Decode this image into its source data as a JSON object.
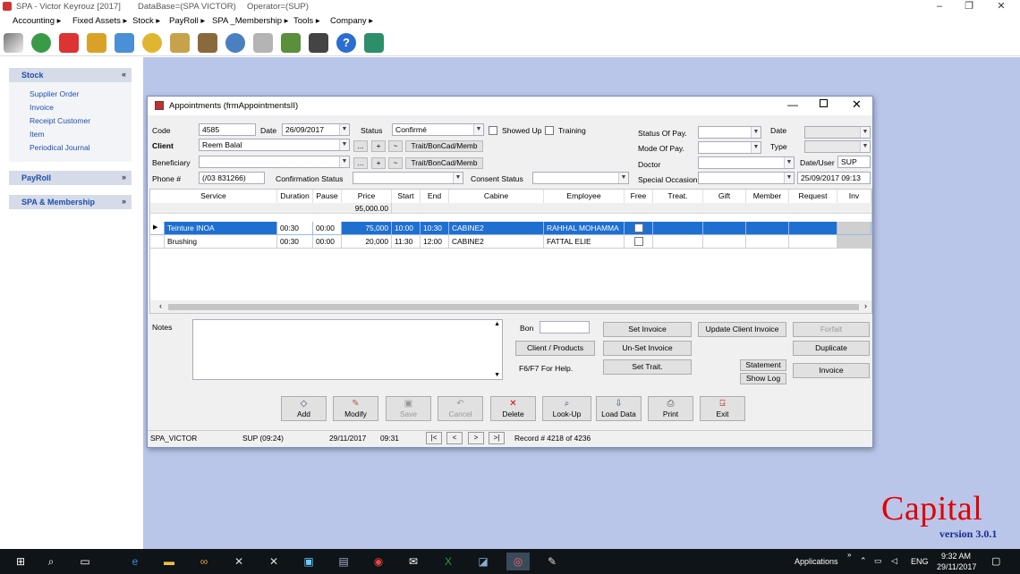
{
  "window": {
    "app_title": "SPA - Victor Keyrouz [2017]",
    "database": "DataBase=(SPA VICTOR)",
    "operator": "Operator=(SUP)"
  },
  "menu": [
    "Accounting ▸",
    "Fixed Assets ▸",
    "Stock ▸",
    "PayRoll ▸",
    "SPA _Membership ▸",
    "Tools ▸",
    "Company ▸"
  ],
  "toolbar_icons": [
    "pencil-icon",
    "money-check-icon",
    "cancel-doc-icon",
    "folder-icon",
    "car-add-icon",
    "coins-icon",
    "scale-icon",
    "clipboard-icon",
    "globe-icon",
    "report-icon",
    "calculator-icon",
    "calendar-icon",
    "help-icon",
    "exit-icon"
  ],
  "sidebar": {
    "stock": {
      "title": "Stock",
      "items": [
        "Supplier Order",
        "Invoice",
        "Receipt Customer",
        "Item",
        "Periodical Journal"
      ]
    },
    "payroll": {
      "title": "PayRoll"
    },
    "spa": {
      "title": "SPA & Membership"
    }
  },
  "dialog": {
    "title": "Appointments  (frmAppointmentsII)",
    "labels": {
      "code": "Code",
      "date": "Date",
      "status": "Status",
      "client": "Client",
      "beneficiary": "Beneficiary",
      "phone": "Phone #",
      "confirmation_status": "Confirmation Status",
      "consent_status": "Consent Status",
      "showed_up": "Showed Up",
      "training": "Training",
      "status_of_pay": "Status Of Pay.",
      "mode_of_pay": "Mode Of Pay.",
      "doctor": "Doctor",
      "special_occasion": "Special Occasion",
      "date2": "Date",
      "type": "Type",
      "date_user": "Date/User"
    },
    "values": {
      "code": "4585",
      "date": "26/09/2017",
      "status": "Confirmé",
      "client": "Reem Balal",
      "beneficiary": "",
      "phone": "(/03 831266)",
      "confirmation_status": "",
      "consent_status": "",
      "status_of_pay": "",
      "mode_of_pay": "",
      "doctor": "",
      "special_occasion": "",
      "date2": "",
      "type": "",
      "user": "SUP",
      "datetime": "25/09/2017 09:13"
    },
    "small_buttons": {
      "dots": "...",
      "plus": "+",
      "tilde": "~",
      "trait": "Trait/BonCad/Memb"
    },
    "grid": {
      "columns": [
        "Service",
        "Duration",
        "Pause",
        "Price",
        "Start",
        "End",
        "Cabine",
        "Employee",
        "Free",
        "Treat.",
        "Gift",
        "Member",
        "Request",
        "Inv"
      ],
      "price_total": "95,000.00",
      "rows": [
        {
          "service": "Teinture INOA",
          "duration": "00:30",
          "pause": "00:00",
          "price": "75,000",
          "start": "10:00",
          "end": "10:30",
          "cabine": "CABINE2",
          "employee": "RAHHAL MOHAMMA",
          "selected": true
        },
        {
          "service": "Brushing",
          "duration": "00:30",
          "pause": "00:00",
          "price": "20,000",
          "start": "11:30",
          "end": "12:00",
          "cabine": "CABINE2",
          "employee": "FATTAL ELIE",
          "selected": false
        }
      ]
    },
    "notes_label": "Notes",
    "bon_label": "Bon",
    "help_text": "F6/F7 For Help.",
    "buttons": {
      "client_products": "Client / Products",
      "set_invoice": "Set Invoice",
      "unset_invoice": "Un-Set Invoice",
      "set_trait": "Set Trait.",
      "update_client_invoice": "Update Client Invoice",
      "forfait": "Forfait",
      "duplicate": "Duplicate",
      "statement": "Statement",
      "show_log": "Show Log",
      "invoice": "Invoice"
    },
    "actions": [
      "Add",
      "Modify",
      "Save",
      "Cancel",
      "Delete",
      "Look-Up",
      "Load Data",
      "Print",
      "Exit"
    ],
    "status": {
      "db": "SPA_VICTOR",
      "user": "SUP (09:24)",
      "date": "29/11/2017",
      "time": "09:31",
      "record": "Record #  4218 of 4236"
    },
    "nav": [
      "|<",
      "<",
      ">",
      ">|"
    ]
  },
  "brand": {
    "name": "Capital",
    "version": "version 3.0.1"
  },
  "taskbar": {
    "applications": "Applications",
    "lang": "ENG",
    "time": "9:32 AM",
    "date": "29/11/2017"
  },
  "colors": {
    "workspace": "#b9c6ea",
    "selected_row": "#1f6fd0",
    "brand_red": "#e20000",
    "link_blue": "#1f4fa8"
  }
}
